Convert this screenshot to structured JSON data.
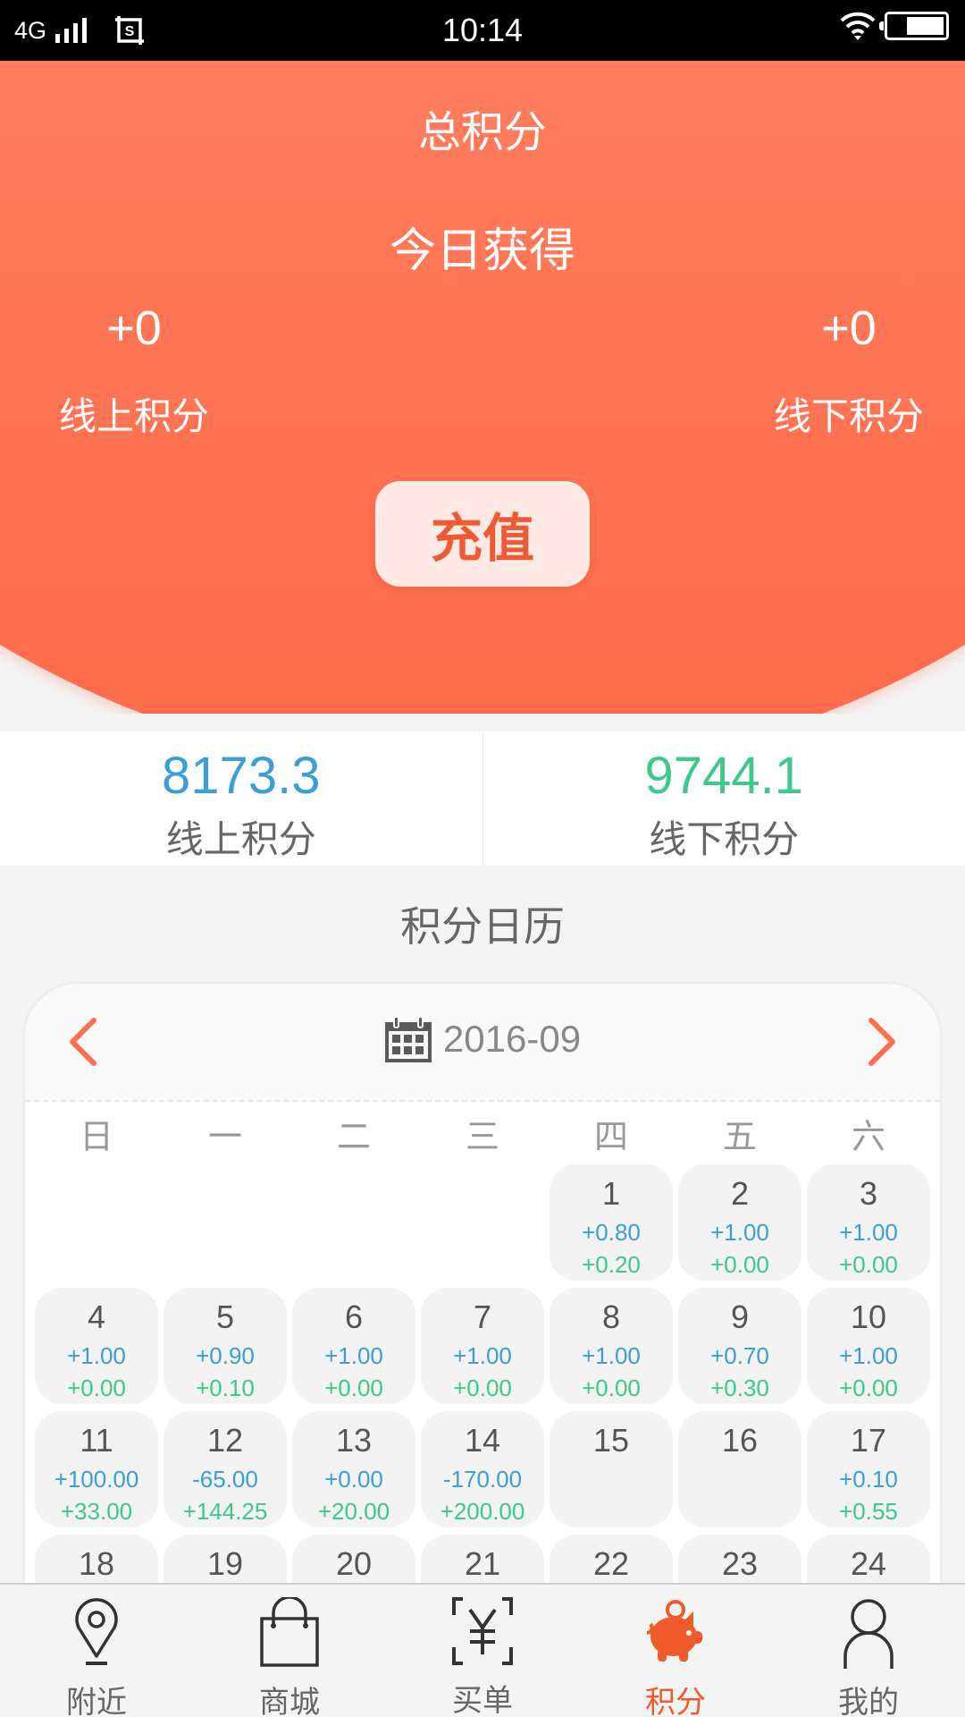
{
  "status_bar": {
    "network": "4G",
    "time": "10:14",
    "icons": [
      "signal-icon",
      "screenshot-icon",
      "wifi-icon",
      "battery-icon"
    ]
  },
  "header": {
    "title": "总积分",
    "today_title": "今日获得",
    "today_online": {
      "value": "+0",
      "label": "线上积分"
    },
    "today_offline": {
      "value": "+0",
      "label": "线下积分"
    },
    "recharge_label": "充值"
  },
  "totals": {
    "online": {
      "value": "8173.3",
      "label": "线上积分"
    },
    "offline": {
      "value": "9744.1",
      "label": "线下积分"
    }
  },
  "calendar": {
    "title": "积分日历",
    "month": "2016-09",
    "prev_icon": "chevron-left-icon",
    "next_icon": "chevron-right-icon",
    "weekdays": [
      "日",
      "一",
      "二",
      "三",
      "四",
      "五",
      "六"
    ],
    "leading_blanks": 4,
    "days": [
      {
        "day": "1",
        "online": "+0.80",
        "offline": "+0.20"
      },
      {
        "day": "2",
        "online": "+1.00",
        "offline": "+0.00"
      },
      {
        "day": "3",
        "online": "+1.00",
        "offline": "+0.00"
      },
      {
        "day": "4",
        "online": "+1.00",
        "offline": "+0.00"
      },
      {
        "day": "5",
        "online": "+0.90",
        "offline": "+0.10"
      },
      {
        "day": "6",
        "online": "+1.00",
        "offline": "+0.00"
      },
      {
        "day": "7",
        "online": "+1.00",
        "offline": "+0.00"
      },
      {
        "day": "8",
        "online": "+1.00",
        "offline": "+0.00"
      },
      {
        "day": "9",
        "online": "+0.70",
        "offline": "+0.30"
      },
      {
        "day": "10",
        "online": "+1.00",
        "offline": "+0.00"
      },
      {
        "day": "11",
        "online": "+100.00",
        "offline": "+33.00"
      },
      {
        "day": "12",
        "online": "-65.00",
        "offline": "+144.25"
      },
      {
        "day": "13",
        "online": "+0.00",
        "offline": "+20.00"
      },
      {
        "day": "14",
        "online": "-170.00",
        "offline": "+200.00"
      },
      {
        "day": "15",
        "online": "",
        "offline": ""
      },
      {
        "day": "16",
        "online": "",
        "offline": ""
      },
      {
        "day": "17",
        "online": "+0.10",
        "offline": "+0.55"
      },
      {
        "day": "18",
        "online": "",
        "offline": ""
      },
      {
        "day": "19",
        "online": "",
        "offline": ""
      },
      {
        "day": "20",
        "online": "",
        "offline": ""
      },
      {
        "day": "21",
        "online": "",
        "offline": ""
      },
      {
        "day": "22",
        "online": "",
        "offline": ""
      },
      {
        "day": "23",
        "online": "",
        "offline": ""
      },
      {
        "day": "24",
        "online": "",
        "offline": ""
      }
    ]
  },
  "tabbar": {
    "items": [
      {
        "label": "附近",
        "icon": "location-pin-icon",
        "active": false
      },
      {
        "label": "商城",
        "icon": "shopping-bag-icon",
        "active": false
      },
      {
        "label": "买单",
        "icon": "scan-yuan-icon",
        "active": false
      },
      {
        "label": "积分",
        "icon": "piggy-bank-icon",
        "active": true
      },
      {
        "label": "我的",
        "icon": "user-icon",
        "active": false
      }
    ]
  },
  "colors": {
    "accent": "#ff7053",
    "online_blue": "#3a9fd6",
    "offline_green": "#3ec88a",
    "active_tab": "#f05a2a"
  }
}
